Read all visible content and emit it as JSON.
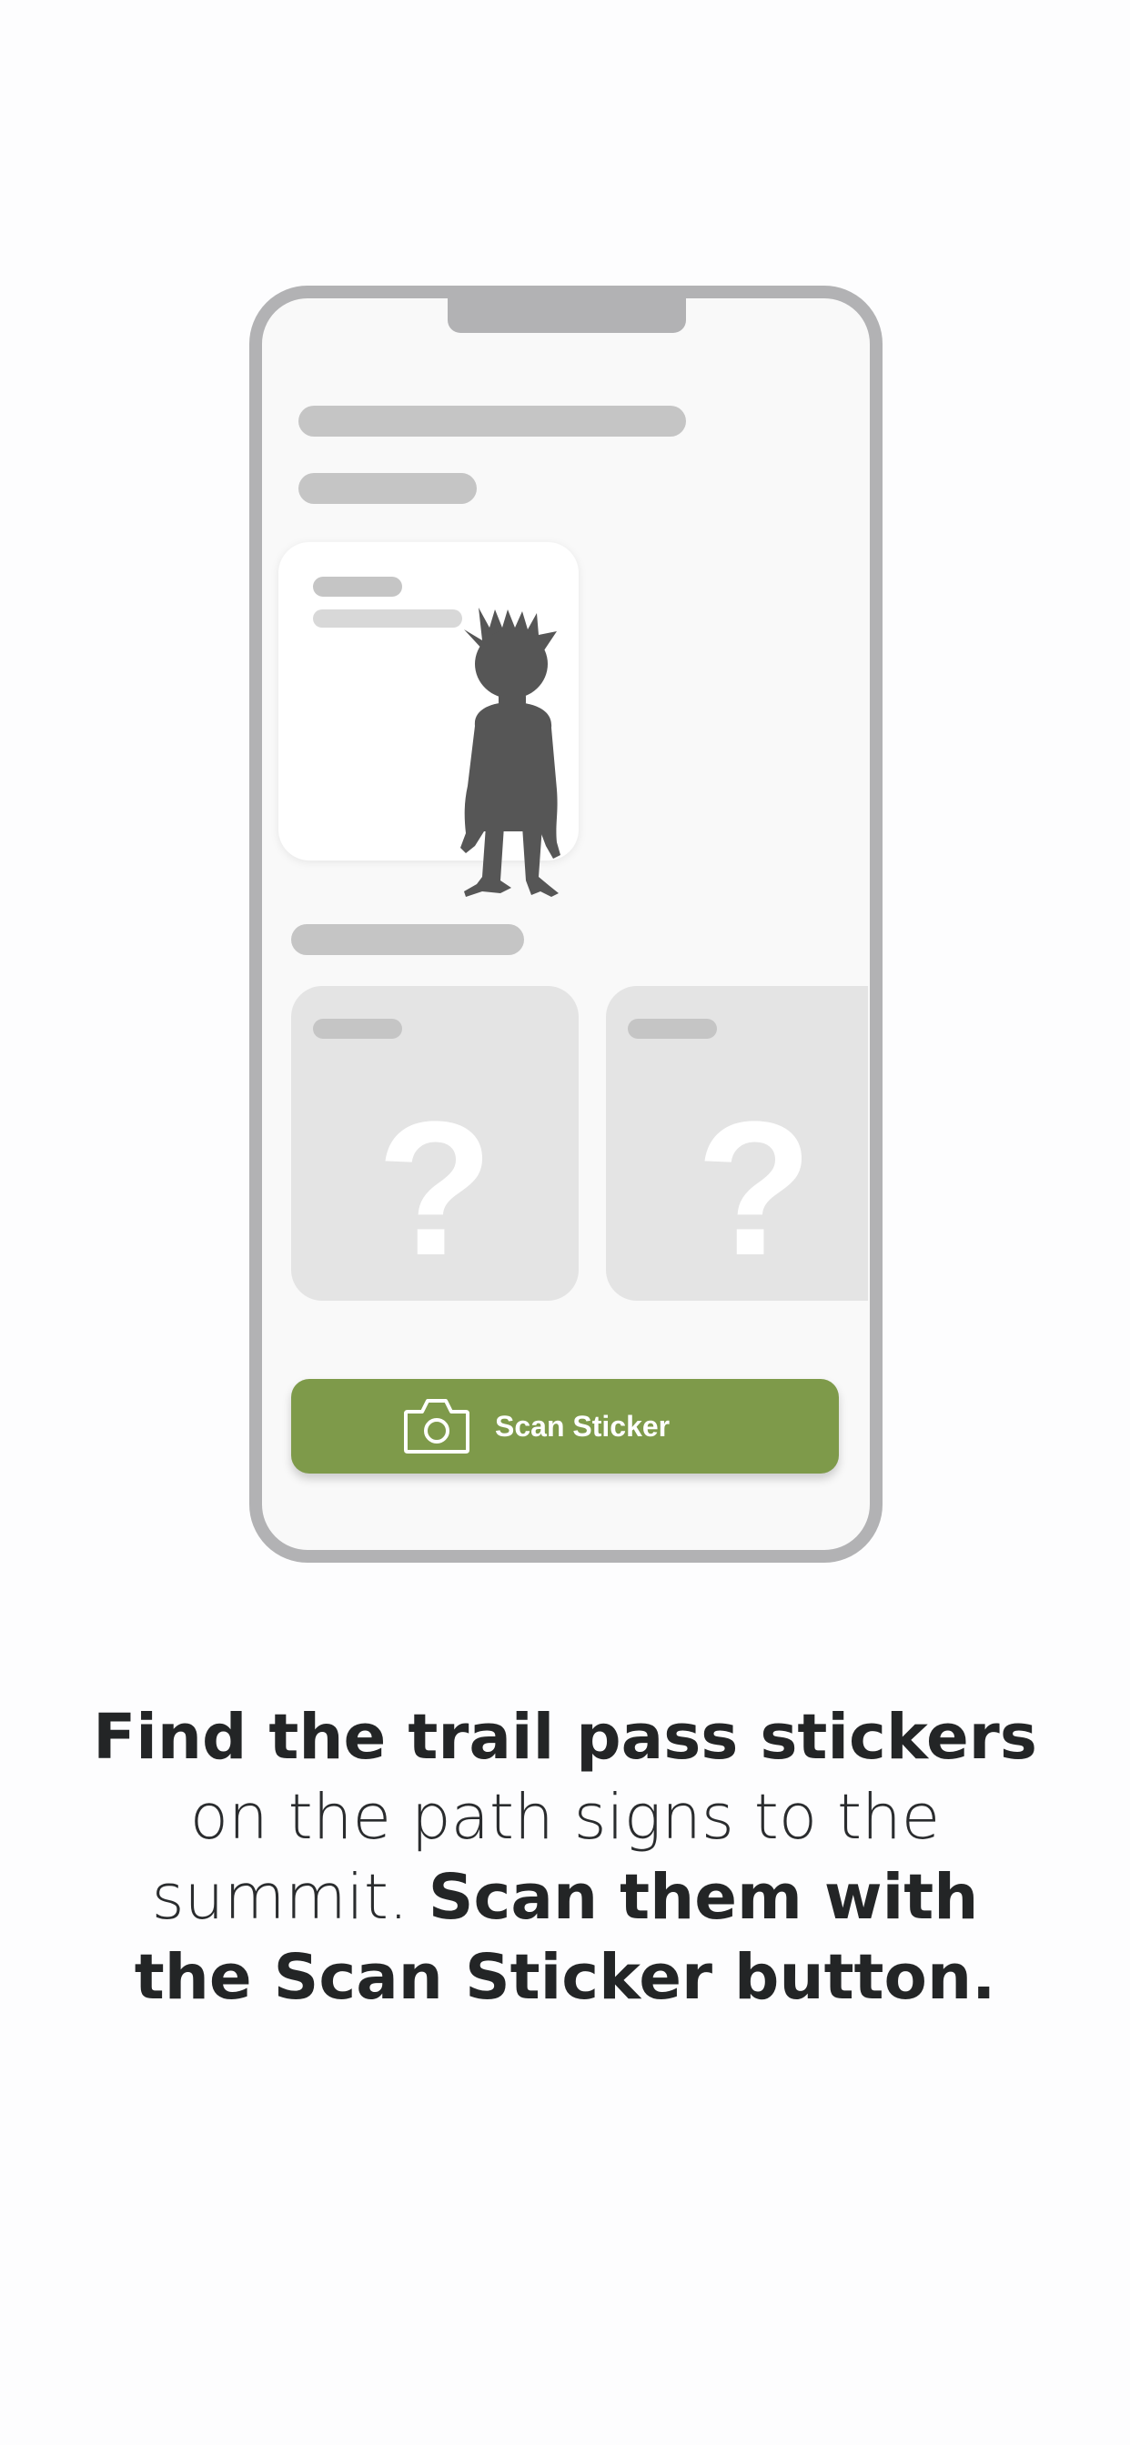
{
  "illustration": {
    "scan_button_label": "Scan Sticker",
    "locked_cards": [
      {
        "symbol": "?"
      },
      {
        "symbol": "?"
      }
    ],
    "icons": {
      "camera": "camera-icon",
      "character": "monster-silhouette"
    }
  },
  "instructions": {
    "part1_bold": "Find the trail pass stickers",
    "part2_regular": "on the path signs to the summit.",
    "part3_bold": "Scan them with the Scan Sticker button."
  },
  "colors": {
    "accent": "#7e9a4a",
    "phone_frame": "#b2b2b4",
    "placeholder": "#c5c5c5",
    "text": "#232526"
  }
}
